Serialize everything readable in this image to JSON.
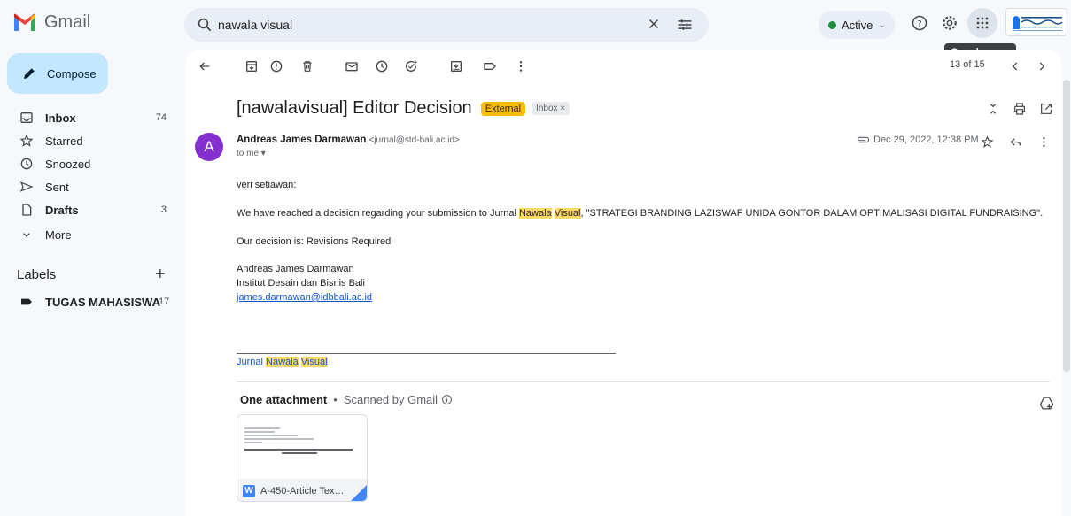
{
  "app": {
    "name": "Gmail"
  },
  "search": {
    "query": "nawala visual"
  },
  "status": {
    "label": "Active",
    "color": "#1e8e3e"
  },
  "tooltip": {
    "text": "Google apps"
  },
  "compose": {
    "label": "Compose"
  },
  "nav": [
    {
      "label": "Inbox",
      "count": "74",
      "icon": "inbox-icon",
      "bold": true
    },
    {
      "label": "Starred",
      "count": "",
      "icon": "star-icon",
      "bold": false
    },
    {
      "label": "Snoozed",
      "count": "",
      "icon": "clock-icon",
      "bold": false
    },
    {
      "label": "Sent",
      "count": "",
      "icon": "send-icon",
      "bold": false
    },
    {
      "label": "Drafts",
      "count": "3",
      "icon": "draft-icon",
      "bold": true
    },
    {
      "label": "More",
      "count": "",
      "icon": "chevron-down-icon",
      "bold": false
    }
  ],
  "labels": {
    "title": "Labels",
    "items": [
      {
        "label": "TUGAS MAHASISWA",
        "count": "17"
      }
    ]
  },
  "pager": {
    "text": "13 of 15"
  },
  "email": {
    "subject": "[nawalavisual] Editor Decision",
    "badge_external": "External",
    "badge_inbox": "Inbox ×",
    "avatar_letter": "A",
    "sender_name": "Andreas James Darmawan",
    "sender_email": "<jurnal@std-bali.ac.id>",
    "to": "to me ▾",
    "date": "Dec 29, 2022, 12:38 PM",
    "greeting": "veri setiawan:",
    "p1_before": "We have reached a decision regarding your submission to Jurnal ",
    "hl_word_1": "Nawala",
    "hl_word_2": "Visual",
    "p1_after": ", \"STRATEGI BRANDING LAZISWAF UNIDA GONTOR DALAM OPTIMALISASI DIGITAL FUNDRAISING\".",
    "decision": "Our decision is: Revisions Required",
    "sig_name": "Andreas James Darmawan",
    "sig_inst": "Institut Desain dan Bisnis Bali",
    "sig_email": "james.darmawan@idbbali.ac.id",
    "footer_link_1": "Jurnal",
    "footer_link_2": "Nawala",
    "footer_link_3": "Visual"
  },
  "attachment": {
    "title": "One attachment",
    "scanned": "Scanned by Gmail",
    "filename": "A-450-Article Tex…",
    "file_type": "W"
  }
}
